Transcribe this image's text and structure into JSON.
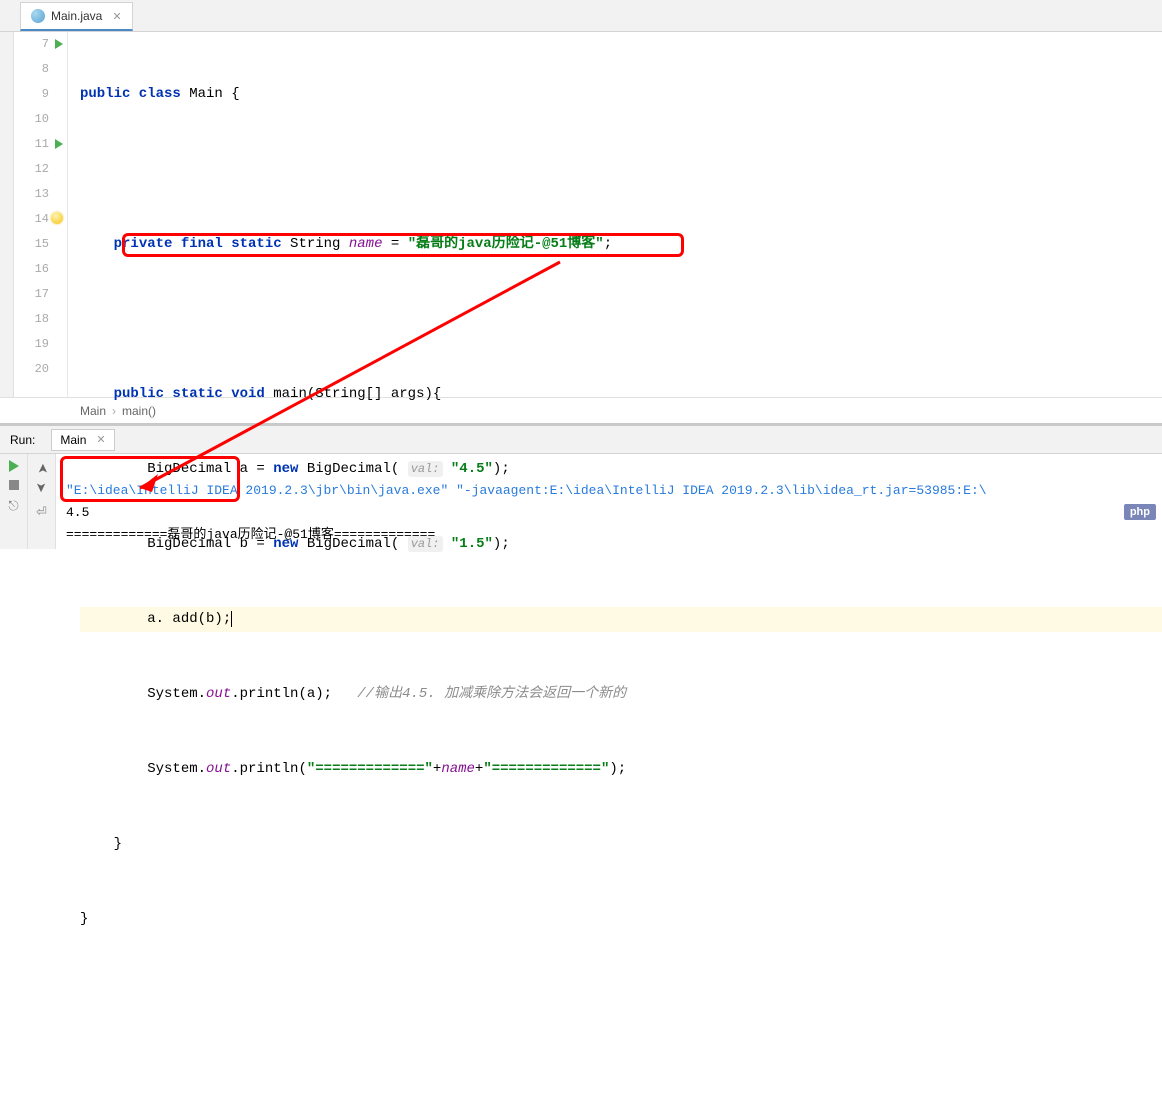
{
  "tab": {
    "filename": "Main.java"
  },
  "gutter": {
    "lines": [
      "7",
      "8",
      "9",
      "10",
      "11",
      "12",
      "13",
      "14",
      "15",
      "16",
      "17",
      "18",
      "19",
      "20"
    ]
  },
  "code": {
    "l7": {
      "kw1": "public class",
      "name": " Main {"
    },
    "l9": {
      "kw": "private final static",
      "type": " String ",
      "field": "name",
      "eq": " = ",
      "str": "\"磊哥的java历险记-@51博客\"",
      "end": ";"
    },
    "l11": {
      "kw": "public static void",
      "name": " main(String[] args){"
    },
    "l12": {
      "pre": "BigDecimal a = ",
      "kw": "new",
      "post": " BigDecimal( ",
      "hint": "val:",
      "str": " \"4.5\"",
      "end": ");"
    },
    "l13": {
      "pre": "BigDecimal b = ",
      "kw": "new",
      "post": " BigDecimal( ",
      "hint": "val:",
      "str": " \"1.5\"",
      "end": ");"
    },
    "l14": {
      "text": "a. add(b);"
    },
    "l15": {
      "sys": "System.",
      "out": "out",
      "rest": ".println(a);   ",
      "comment": "//输出4.5. 加减乘除方法会返回一个新的"
    },
    "l16": {
      "sys": "System.",
      "out": "out",
      "rest1": ".println(",
      "str1": "\"=============\"",
      "plus1": "+",
      "field": "name",
      "plus2": "+",
      "str2": "\"=============\"",
      "end": ");"
    },
    "l17": {
      "text": "}"
    },
    "l18": {
      "text": "}"
    }
  },
  "breadcrumb": {
    "c1": "Main",
    "c2": "main()"
  },
  "run": {
    "label": "Run:",
    "tab": "Main",
    "line1a": "\"E:\\idea\\IntelliJ IDEA 2019.2.3\\jbr\\bin\\java.exe\" \"-javaagent:E:\\idea\\IntelliJ IDEA 2019.2.3\\lib\\idea_rt.jar=53985:E:\\",
    "line2": "4.5",
    "line3": "=============磊哥的java历险记-@51博客============="
  },
  "badge": {
    "text": "php"
  }
}
